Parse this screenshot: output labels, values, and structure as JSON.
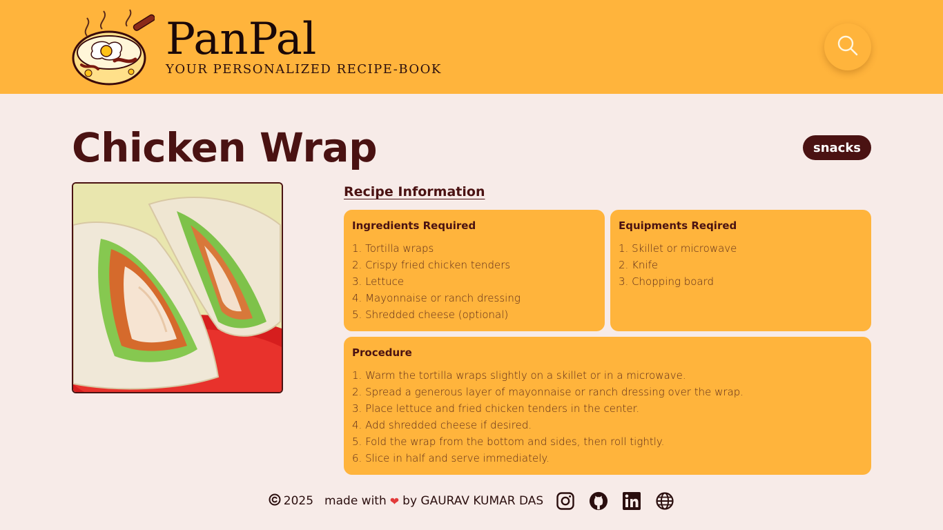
{
  "header": {
    "brand_name": "PanPal",
    "tagline": "YOUR PERSONALIZED RECIPE-BOOK",
    "search_icon": "search-icon",
    "background_color": "#ffb43c"
  },
  "recipe": {
    "title": "Chicken Wrap",
    "category": "snacks",
    "section_heading": "Recipe Information",
    "ingredients": {
      "title": "Ingredients Required",
      "items": [
        "1. Tortilla wraps",
        "2. Crispy fried chicken tenders",
        "3. Lettuce",
        "4. Mayonnaise or ranch dressing",
        "5. Shredded cheese (optional)"
      ]
    },
    "equipment": {
      "title": "Equipments Reqired",
      "items": [
        "1. Skillet or microwave",
        "2. Knife",
        "3. Chopping board"
      ]
    },
    "procedure": {
      "title": "Procedure",
      "items": [
        "1. Warm the tortilla wraps slightly on a skillet or in a microwave.",
        "2. Spread a generous layer of mayonnaise or ranch dressing over the wrap.",
        "3. Place lettuce and fried chicken tenders in the center.",
        "4. Add shredded cheese if desired.",
        "5. Fold the wrap from the bottom and sides, then roll tightly.",
        "6. Slice in half and serve immediately."
      ]
    }
  },
  "footer": {
    "copyright": "2025",
    "made_with": "made with",
    "by": "by GAURAV KUMAR DAS",
    "social_icons": [
      "instagram-icon",
      "github-icon",
      "linkedin-icon",
      "globe-icon"
    ]
  },
  "colors": {
    "accent": "#ffb43c",
    "primary_dark": "#4a1212",
    "page_background": "#f7ebe8"
  }
}
